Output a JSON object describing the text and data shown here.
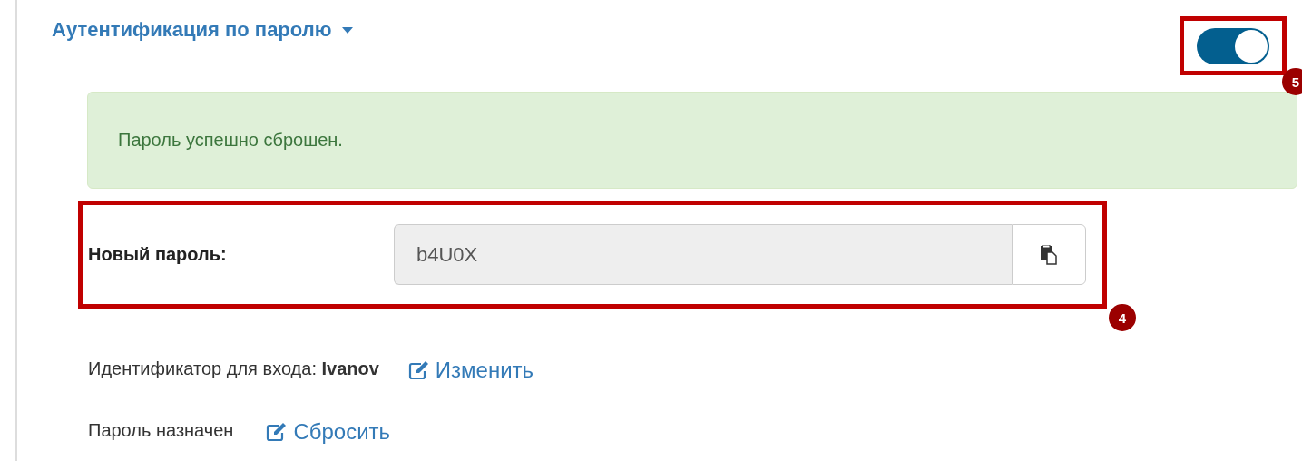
{
  "section": {
    "title": "Аутентификация по паролю",
    "enabled": true,
    "toggle_annotation": "5"
  },
  "alert": {
    "message": "Пароль успешно сброшен."
  },
  "new_password": {
    "label": "Новый пароль:",
    "value": "b4U0X",
    "annotation": "4"
  },
  "login": {
    "text": "Идентификатор для входа: **Ivanov**",
    "link": "Изменить"
  },
  "password": {
    "text": "Пароль назначен",
    "link": "Сбросить"
  }
}
